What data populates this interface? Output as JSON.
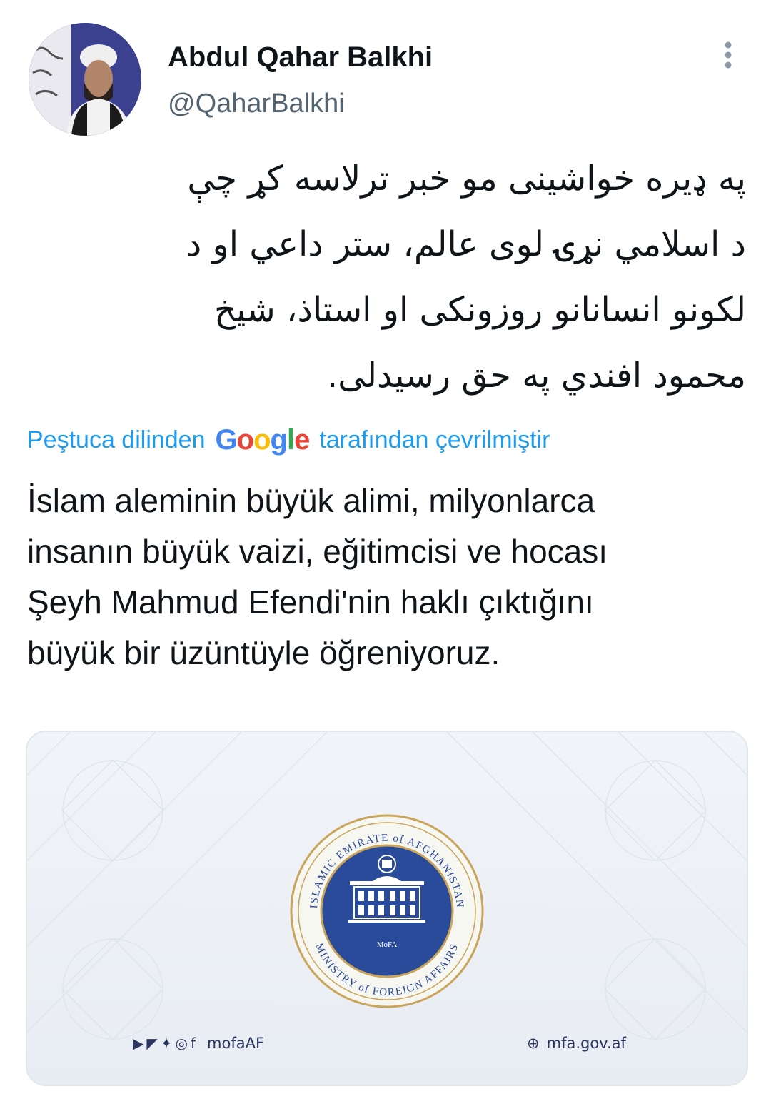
{
  "author": {
    "name": "Abdul Qahar Balkhi",
    "handle": "@QaharBalkhi"
  },
  "tweet": {
    "original_lines": [
      "په ډیره خواشینی مو خبر ترلاسه کړ چې",
      "د اسلامي نړۍ لوی عالم، ستر داعي او د",
      "لکونو انسانانو روزونکی او استاذ، شیخ",
      "محمود افندي په حق رسیدلی."
    ],
    "translation_prefix": "Peştuca dilinden",
    "translation_provider": "Google",
    "translation_suffix": "tarafından çevrilmiştir",
    "translated_lines": [
      "İslam aleminin büyük alimi, milyonlarca",
      "insanın büyük vaizi, eğitimcisi ve hocası",
      "Şeyh Mahmud Efendi'nin haklı çıktığını",
      "büyük bir üzüntüyle öğreniyoruz."
    ]
  },
  "media_card": {
    "seal_ring_top": "ISLAMIC EMIRATE of AFGHANISTAN",
    "seal_ring_bottom": "MINISTRY of FOREIGN AFFAIRS",
    "seal_center": "MoFA",
    "social_icons": [
      "youtube-icon",
      "telegram-icon",
      "twitter-icon",
      "instagram-icon",
      "facebook-icon"
    ],
    "social_handle": "mofaAF",
    "website": "mfa.gov.af"
  },
  "colors": {
    "link": "#1d9bf0",
    "text": "#0f1419",
    "secondary": "#536471",
    "seal_blue": "#2a4a9a",
    "seal_gold": "#c9a45a"
  }
}
